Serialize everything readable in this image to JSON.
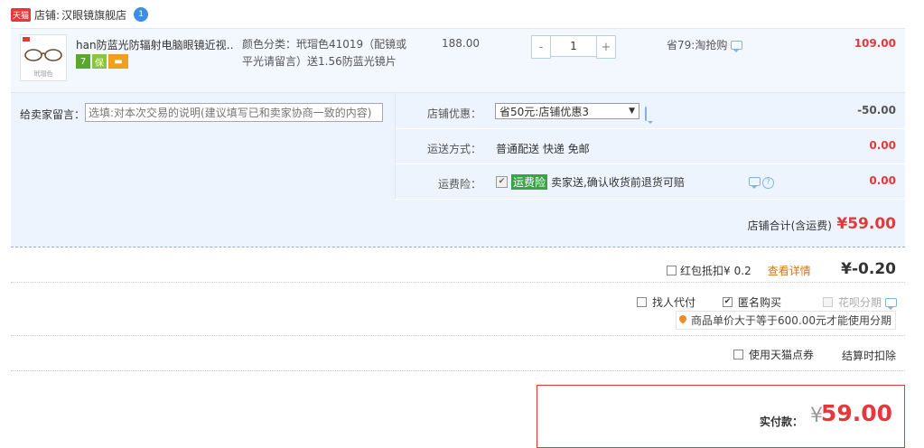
{
  "shop": {
    "badge": "天猫",
    "label": "店铺:",
    "name": "汉眼镜旗舰店",
    "ww_badge": "1"
  },
  "item": {
    "thumb_text": "玳瑁色",
    "title": "han防蓝光防辐射电脑眼镜近视…",
    "sku_line1": "颜色分类：玳瑁色41019（配镜或",
    "sku_line2": "平光请留言）送1.56防蓝光镜片",
    "price": "188.00",
    "quantity": "1",
    "minus": "-",
    "plus": "+",
    "promo": "省79:淘抢购",
    "subtotal": "109.00"
  },
  "message": {
    "label": "给卖家留言：",
    "placeholder": "选填:对本次交易的说明(建议填写已和卖家协商一致的内容)"
  },
  "shop_discount": {
    "label": "店铺优惠：",
    "selected": "省50元:店铺优惠3",
    "value": "-50.00"
  },
  "shipping": {
    "label": "运送方式：",
    "text": "普通配送 快递 免邮",
    "value": "0.00"
  },
  "insurance": {
    "label": "运费险：",
    "tag": "运费险",
    "text": "卖家送,确认收货前退货可赔",
    "value": "0.00"
  },
  "shop_total": {
    "label": "店铺合计(含运费)",
    "value": "¥59.00"
  },
  "redpacket": {
    "label": "红包抵扣¥",
    "amount": "0.2",
    "link": "查看详情",
    "value": "¥-0.20"
  },
  "options": {
    "proxy_pay": "找人代付",
    "anonymous": "匿名购买",
    "huabei": "花呗分期",
    "tip": "商品单价大于等于600.00元才能使用分期"
  },
  "points": {
    "label": "使用天猫点券",
    "note": "结算时扣除"
  },
  "payment": {
    "label": "实付款：",
    "yen": "¥",
    "value": "59.00"
  },
  "colors": {
    "accent_red": "#e4393c",
    "panel_blue": "#eef4fe",
    "link_orange": "#d0761b"
  }
}
